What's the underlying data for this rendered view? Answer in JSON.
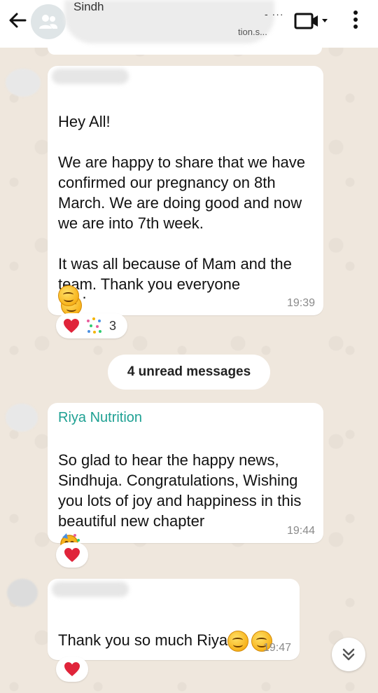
{
  "header": {
    "title_visible": "Sindh",
    "subtitle_visible": "tion.s...",
    "icons": [
      "back-arrow-icon",
      "group-avatar-icon",
      "video-call-icon",
      "dropdown-icon",
      "more-vert-icon"
    ]
  },
  "messages": [
    {
      "sender": "",
      "text": "Hey All!\n\nWe are happy to share that we have confirmed our pregnancy on 8th March. We are doing good and now we are into 7th week.\n\nIt was all because of Mam and the team. Thank you everyone",
      "text_tail": ".",
      "time": "19:39",
      "reactions": {
        "count": "3",
        "icons": [
          "heart-icon",
          "confetti-icon"
        ]
      }
    },
    {
      "sender": "Riya Nutrition",
      "text": "So glad to hear the happy news, Sindhuja. Congratulations, Wishing you lots of joy and happiness in this beautiful new chapter",
      "time": "19:44",
      "reactions": {
        "icons": [
          "heart-icon"
        ]
      }
    },
    {
      "sender": "",
      "text": "Thank you so much Riya",
      "time": "19:47",
      "reactions": {
        "icons": [
          "heart-icon"
        ]
      }
    }
  ],
  "unread_label": "4 unread messages",
  "colors": {
    "sender_name": "#1fa193",
    "heart": "#e0243a",
    "background": "#efe7dd"
  }
}
